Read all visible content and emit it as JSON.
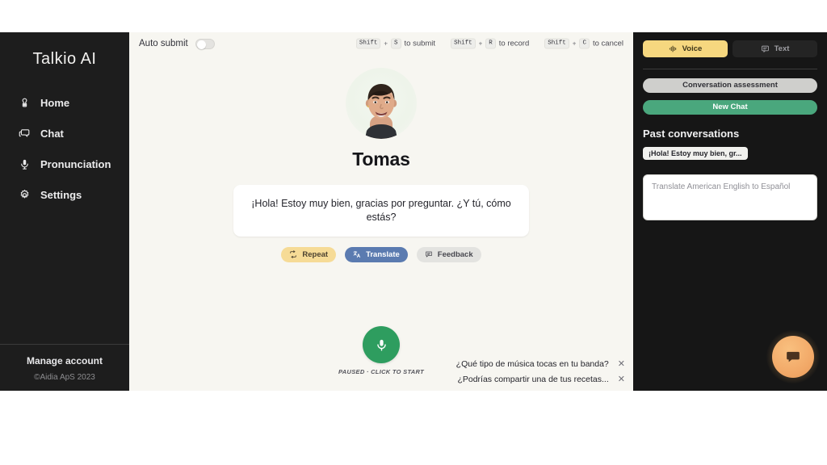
{
  "sidebar": {
    "brand": "Talkio AI",
    "items": [
      {
        "label": "Home",
        "icon": "home-icon"
      },
      {
        "label": "Chat",
        "icon": "chat-icon"
      },
      {
        "label": "Pronunciation",
        "icon": "microphone-icon"
      },
      {
        "label": "Settings",
        "icon": "gear-icon"
      }
    ],
    "manage_account": "Manage account",
    "copyright": "©Aidia ApS 2023"
  },
  "topbar": {
    "auto_submit_label": "Auto submit",
    "auto_submit_on": false,
    "shortcuts": [
      {
        "key": "Shift",
        "plus": "+",
        "key2": "S",
        "text": "to submit"
      },
      {
        "key": "Shift",
        "plus": "+",
        "key2": "R",
        "text": "to record"
      },
      {
        "key": "Shift",
        "plus": "+",
        "key2": "C",
        "text": "to cancel"
      }
    ]
  },
  "conversation": {
    "persona_name": "Tomas",
    "message": "¡Hola! Estoy muy bien, gracias por preguntar. ¿Y tú, cómo estás?",
    "actions": [
      {
        "label": "Repeat",
        "icon": "repeat-icon"
      },
      {
        "label": "Translate",
        "icon": "translate-icon"
      },
      {
        "label": "Feedback",
        "icon": "feedback-icon"
      }
    ],
    "mic_status": "PAUSED · CLICK TO START",
    "suggestions": [
      {
        "text": "¿Qué tipo de música tocas en tu banda?",
        "close": "✕"
      },
      {
        "text": "¿Podrías compartir una de tus recetas...",
        "close": "✕"
      }
    ]
  },
  "right_panel": {
    "tabs": [
      {
        "label": "Voice",
        "icon": "waveform-icon",
        "active": true
      },
      {
        "label": "Text",
        "icon": "text-bubble-icon",
        "active": false
      }
    ],
    "assessment_label": "Conversation assessment",
    "new_chat_label": "New Chat",
    "past_conversations_title": "Past conversations",
    "past_conversations": [
      {
        "label": "¡Hola! Estoy muy bien, gr..."
      }
    ],
    "translate_placeholder": "Translate American English to Español",
    "translate_value": ""
  },
  "fab": {
    "icon": "chat-bubble-icon"
  },
  "colors": {
    "sidebar_bg": "#1d1d1d",
    "panel_bg": "#161616",
    "canvas_bg": "#f7f6f1",
    "accent_yellow": "#f6d77f",
    "accent_green": "#4aa77d",
    "mic_green": "#2e9d5f",
    "translate_blue": "#5b7bb0",
    "fab_orange": "#f2a968"
  }
}
